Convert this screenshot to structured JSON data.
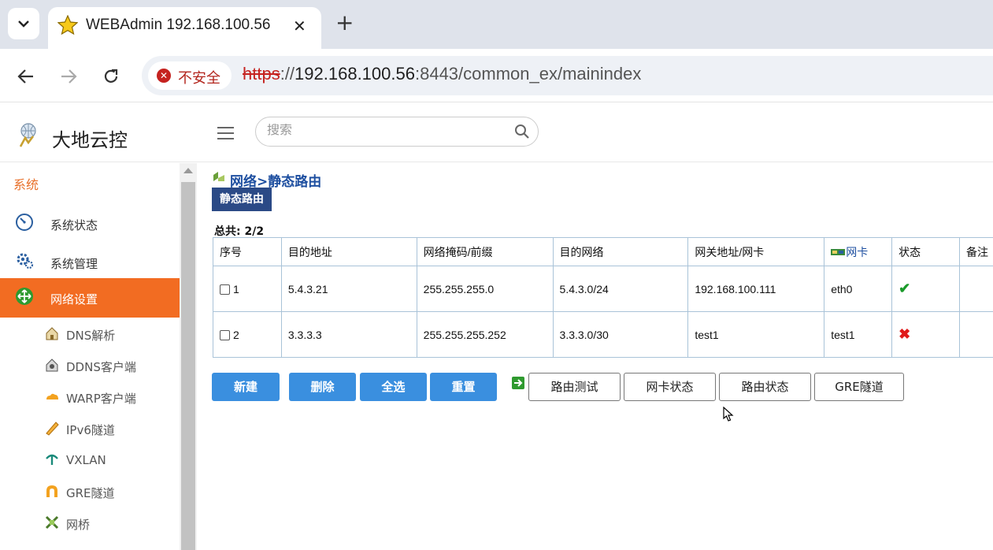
{
  "browser": {
    "tab_title": "WEBAdmin 192.168.100.56",
    "close_glyph": "✕",
    "new_tab_glyph": "+",
    "security_label": "不安全",
    "url_scheme": "https",
    "url_sep": "://",
    "url_host": "192.168.100.56",
    "url_rest": ":8443/common_ex/mainindex"
  },
  "header": {
    "brand": "大地云控",
    "search_placeholder": "搜索"
  },
  "sidebar": {
    "section": "系统",
    "items": [
      {
        "label": "系统状态",
        "icon": "gauge-icon"
      },
      {
        "label": "系统管理",
        "icon": "gear-icon"
      },
      {
        "label": "网络设置",
        "icon": "network-icon",
        "active": true
      }
    ],
    "subitems": [
      {
        "label": "DNS解析",
        "icon": "dns-icon"
      },
      {
        "label": "DDNS客户端",
        "icon": "ddns-icon"
      },
      {
        "label": "WARP客户端",
        "icon": "cloud-icon"
      },
      {
        "label": "IPv6隧道",
        "icon": "ipv6-icon"
      },
      {
        "label": "VXLAN",
        "icon": "vxlan-icon"
      },
      {
        "label": "GRE隧道",
        "icon": "gre-icon"
      },
      {
        "label": "网桥",
        "icon": "bridge-icon"
      }
    ]
  },
  "main": {
    "breadcrumb": "网络>静态路由",
    "subtab": "静态路由",
    "total": "总共: 2/2",
    "columns": [
      "序号",
      "目的地址",
      "网络掩码/前缀",
      "目的网络",
      "网关地址/网卡",
      "网卡",
      "状态",
      "备注"
    ],
    "rows": [
      {
        "no": "1",
        "dest": "5.4.3.21",
        "mask": "255.255.255.0",
        "net": "5.4.3.0/24",
        "gateway": "192.168.100.111",
        "nic": "eth0",
        "status": "enabled",
        "status_glyph": "✔",
        "note": ""
      },
      {
        "no": "2",
        "dest": "3.3.3.3",
        "mask": "255.255.255.252",
        "net": "3.3.3.0/30",
        "gateway": "test1",
        "nic": "test1",
        "status": "disabled",
        "status_glyph": "✖",
        "note": ""
      }
    ],
    "buttons": {
      "new": "新建",
      "delete": "删除",
      "select_all": "全选",
      "reset": "重置",
      "route_test": "路由测试",
      "nic_status": "网卡状态",
      "route_status": "路由状态",
      "gre_tunnel": "GRE隧道"
    }
  },
  "colors": {
    "accent": "#f26c22",
    "nav_blue": "#1e4fa0",
    "button_blue": "#3a8fdf",
    "error_red": "#d21f1f",
    "ok_green": "#1a9a2a"
  }
}
